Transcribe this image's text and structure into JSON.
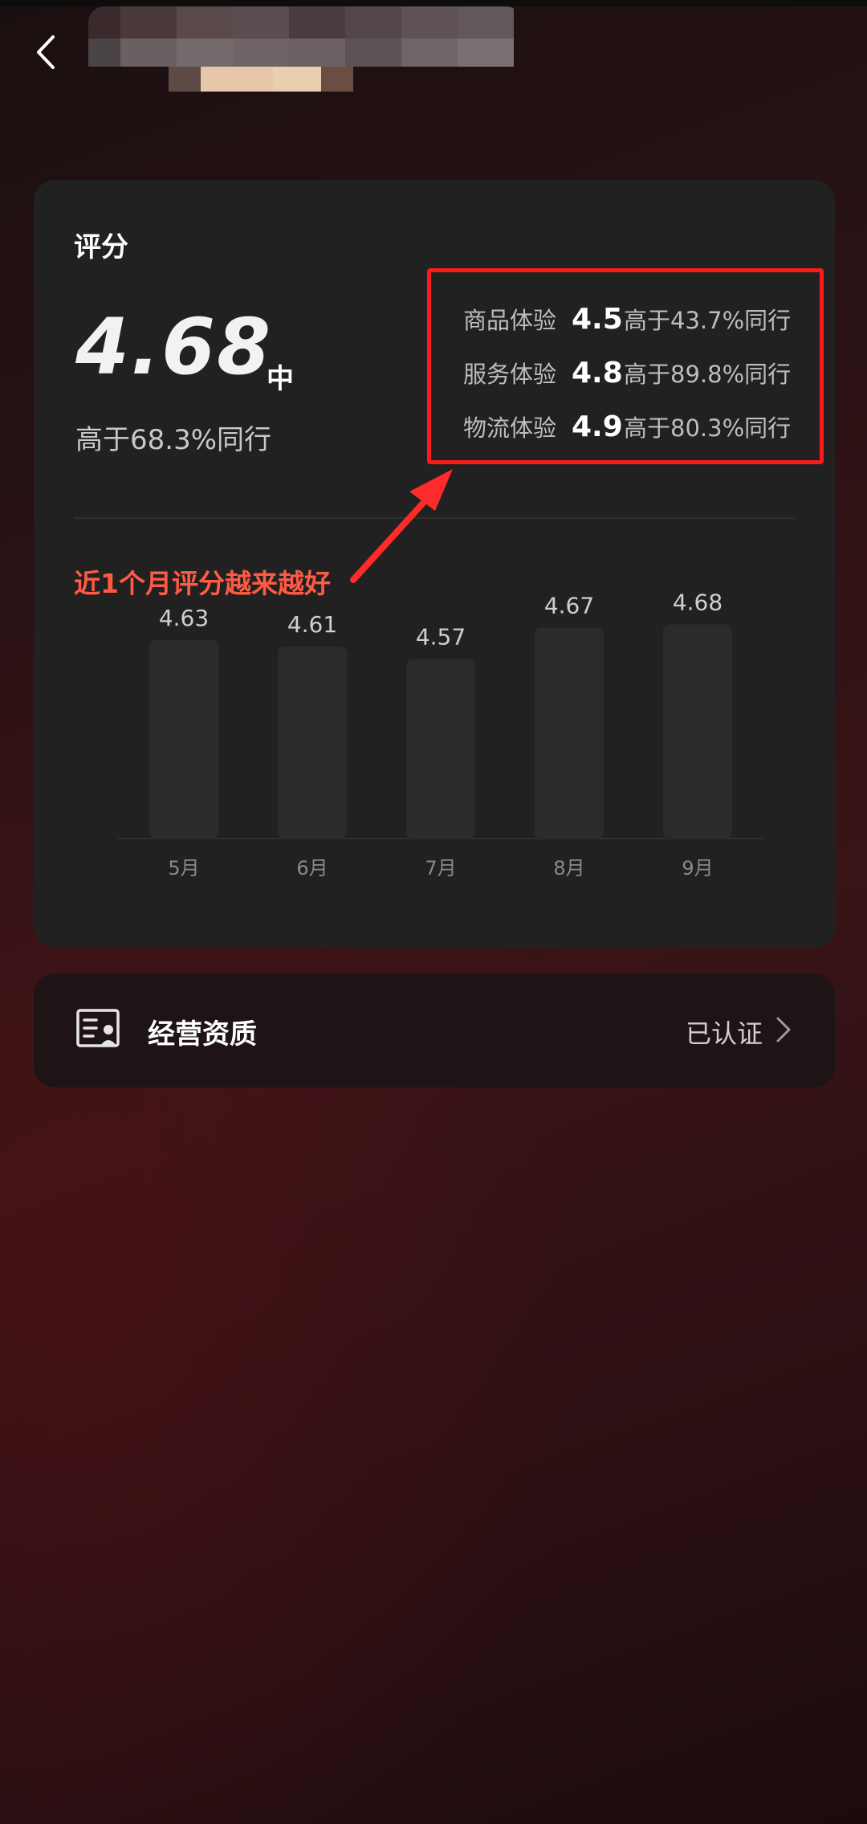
{
  "header": {
    "back_icon": "chevron-left-icon",
    "shop_name_blurred": true
  },
  "score_card": {
    "title": "评分",
    "overall_score": "4.68",
    "level": "中",
    "percentile": "高于68.3%同行",
    "sub_scores": [
      {
        "label": "商品体验",
        "value": "4.5",
        "percentile": "高于43.7%同行"
      },
      {
        "label": "服务体验",
        "value": "4.8",
        "percentile": "高于89.8%同行"
      },
      {
        "label": "物流体验",
        "value": "4.9",
        "percentile": "高于80.3%同行"
      }
    ],
    "highlight_color": "#ff1a1a",
    "annotation": "近1个月评分越来越好",
    "annotation_color": "#ff5a44"
  },
  "chart_data": {
    "type": "bar",
    "categories": [
      "5月",
      "6月",
      "7月",
      "8月",
      "9月"
    ],
    "values": [
      4.63,
      4.61,
      4.57,
      4.67,
      4.68
    ],
    "value_labels": [
      "4.63",
      "4.61",
      "4.57",
      "4.67",
      "4.68"
    ],
    "ylim": [
      0,
      5
    ],
    "grid": false,
    "legend": "none",
    "bar_color": "#2b2b2b"
  },
  "qualification": {
    "icon": "certificate-icon",
    "label": "经营资质",
    "status": "已认证",
    "chevron_icon": "chevron-right-icon"
  }
}
